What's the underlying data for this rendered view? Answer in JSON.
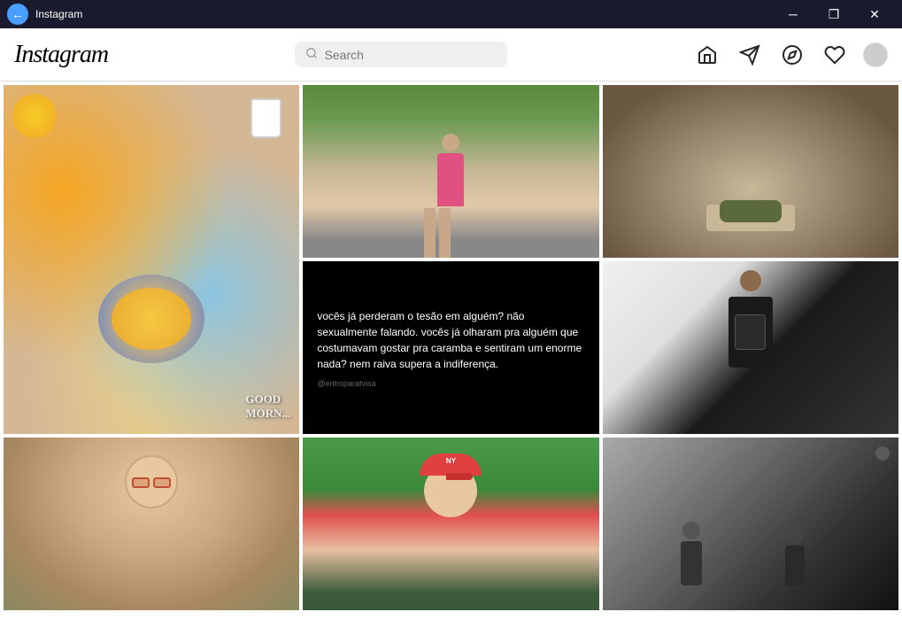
{
  "titlebar": {
    "back_label": "←",
    "title": "Instagram",
    "minimize_label": "─",
    "maximize_label": "❐",
    "close_label": "✕"
  },
  "header": {
    "logo": "Instagram",
    "search": {
      "placeholder": "Search"
    },
    "nav": {
      "home_label": "Home",
      "send_label": "Direct",
      "explore_label": "Explore",
      "heart_label": "Activity",
      "profile_label": "Profile"
    }
  },
  "feed": {
    "posts": [
      {
        "id": "post-1",
        "type": "food",
        "alt": "Breakfast with eggs and coffee",
        "good_morning": "GOOD\nMORN..."
      },
      {
        "id": "post-2",
        "type": "girl-outdoor",
        "alt": "Girl in bikini outdoors"
      },
      {
        "id": "post-3",
        "type": "animal-hand",
        "alt": "Small reptile on hand"
      },
      {
        "id": "post-4",
        "type": "text-quote",
        "alt": "Text quote post",
        "quote": "vocês já perderam o tesão em alguém? não sexualmente falando. vocês já olharam pra alguém que costumavam gostar pra caramba e sentiram um enorme nada? nem raiva supera a indiferença.",
        "handle": "@entroparatvisa"
      },
      {
        "id": "post-5",
        "type": "soccer-player",
        "alt": "Soccer player with watch box"
      },
      {
        "id": "post-6",
        "type": "woman-glasses",
        "alt": "Woman with glasses selfie"
      },
      {
        "id": "post-7",
        "type": "girl-cap",
        "alt": "Girl with pink NY cap"
      },
      {
        "id": "post-8",
        "type": "couple-bw",
        "alt": "Couple in black and white"
      }
    ]
  }
}
